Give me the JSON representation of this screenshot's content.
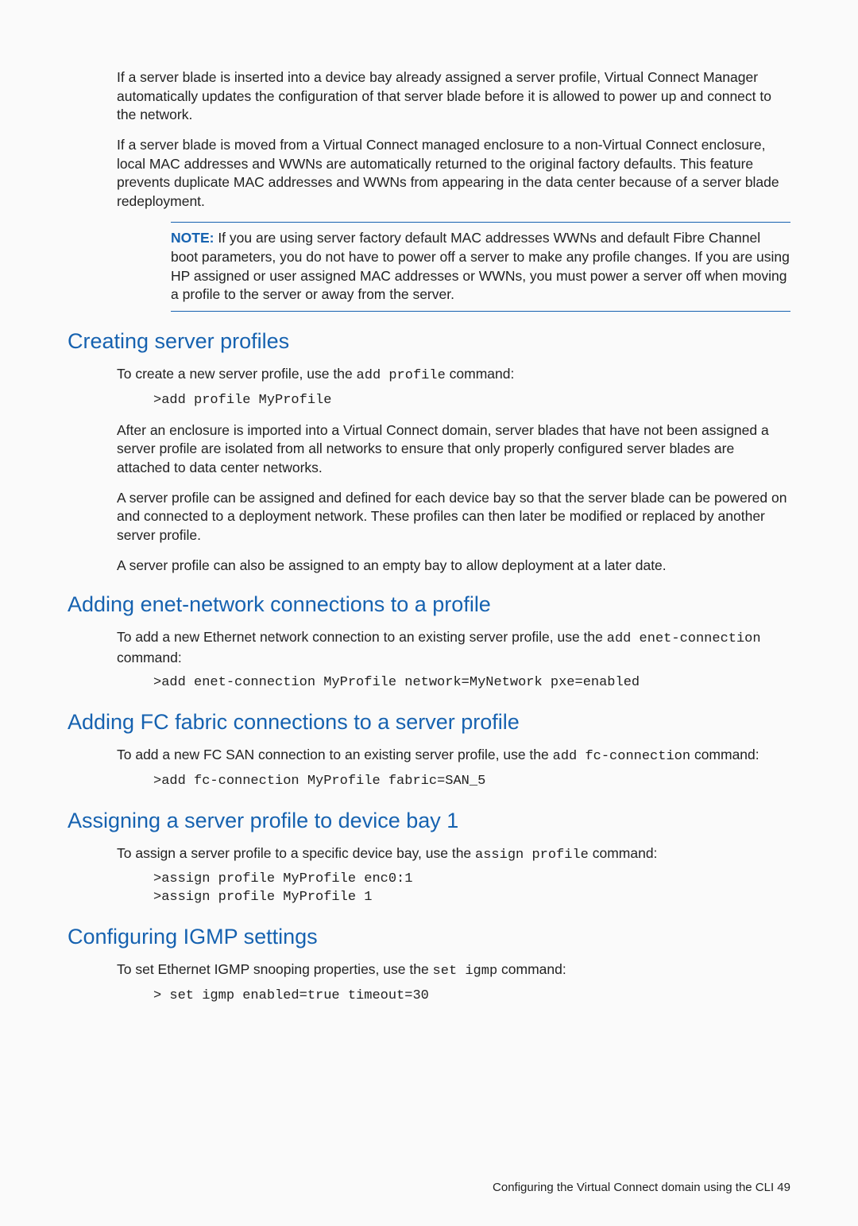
{
  "intro": {
    "p1": "If a server blade is inserted into a device bay already assigned a server profile, Virtual Connect Manager automatically updates the configuration of that server blade before it is allowed to power up and connect to the network.",
    "p2": "If a server blade is moved from a Virtual Connect managed enclosure to a non-Virtual Connect enclosure, local MAC addresses and WWNs are automatically returned to the original factory defaults. This feature prevents duplicate MAC addresses and WWNs from appearing in the data center because of a server blade redeployment."
  },
  "note": {
    "label": "NOTE:",
    "text": "  If you are using server factory default MAC addresses WWNs and default Fibre Channel boot parameters, you do not have to power off a server to make any profile changes. If you are using HP assigned or user assigned MAC addresses or WWNs, you must power a server off when moving a profile to the server or away from the server."
  },
  "sec1": {
    "heading": "Creating server profiles",
    "p1a": "To create a new server profile, use the ",
    "p1cmd": "add profile",
    "p1b": " command:",
    "code1": ">add profile MyProfile",
    "p2": "After an enclosure is imported into a Virtual Connect domain, server blades that have not been assigned a server profile are isolated from all networks to ensure that only properly configured server blades are attached to data center networks.",
    "p3": "A server profile can be assigned and defined for each device bay so that the server blade can be powered on and connected to a deployment network. These profiles can then later be modified or replaced by another server profile.",
    "p4": "A server profile can also be assigned to an empty bay to allow deployment at a later date."
  },
  "sec2": {
    "heading": "Adding enet-network connections to a profile",
    "p1a": "To add a new Ethernet network connection to an existing server profile, use the ",
    "p1cmd": "add enet-connection",
    "p1b": " command:",
    "code1": ">add enet-connection MyProfile network=MyNetwork pxe=enabled"
  },
  "sec3": {
    "heading": "Adding FC fabric connections to a server profile",
    "p1a": "To add a new FC SAN connection to an existing server profile, use the ",
    "p1cmd": "add fc-connection",
    "p1b": " command:",
    "code1": ">add fc-connection MyProfile fabric=SAN_5"
  },
  "sec4": {
    "heading": "Assigning a server profile to device bay 1",
    "p1a": "To assign a server profile to a specific device bay, use the ",
    "p1cmd": "assign profile",
    "p1b": " command:",
    "code1": ">assign profile MyProfile enc0:1\n>assign profile MyProfile 1"
  },
  "sec5": {
    "heading": "Configuring IGMP settings",
    "p1a": "To set Ethernet IGMP snooping properties, use the ",
    "p1cmd": "set igmp",
    "p1b": " command:",
    "code1": "> set igmp enabled=true timeout=30"
  },
  "footer": {
    "text": "Configuring the Virtual Connect domain using the CLI   49"
  }
}
